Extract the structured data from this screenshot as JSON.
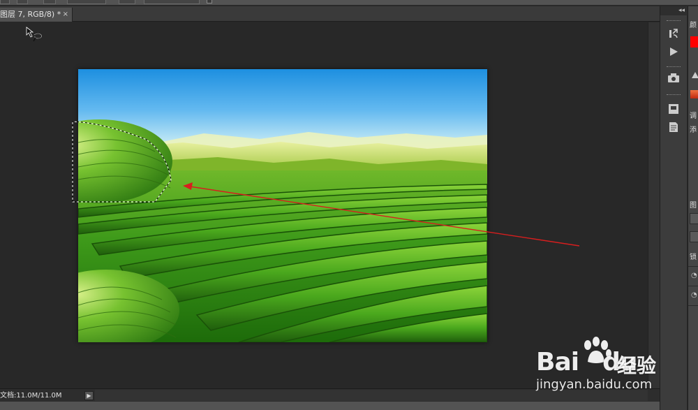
{
  "document_tab": {
    "title": "图层 7, RGB/8) *",
    "close_glyph": "×"
  },
  "status": {
    "doc_info": "文档:11.0M/11.0M",
    "menu_arrow": "▶"
  },
  "right_panel": {
    "collapse_glyph": "◂◂",
    "labels": {
      "color": "颜",
      "adjust": "调",
      "add": "添",
      "layers": "图",
      "lock": "锁"
    },
    "foreground_color": "#ff0000",
    "accent_gradient": "#d9451d"
  },
  "watermark": {
    "brand": "Bai",
    "brand_du": "du",
    "cn_text": "经验",
    "url": "jingyan.baidu.com"
  },
  "annotation": {
    "arrow_color": "#d81e1e"
  }
}
